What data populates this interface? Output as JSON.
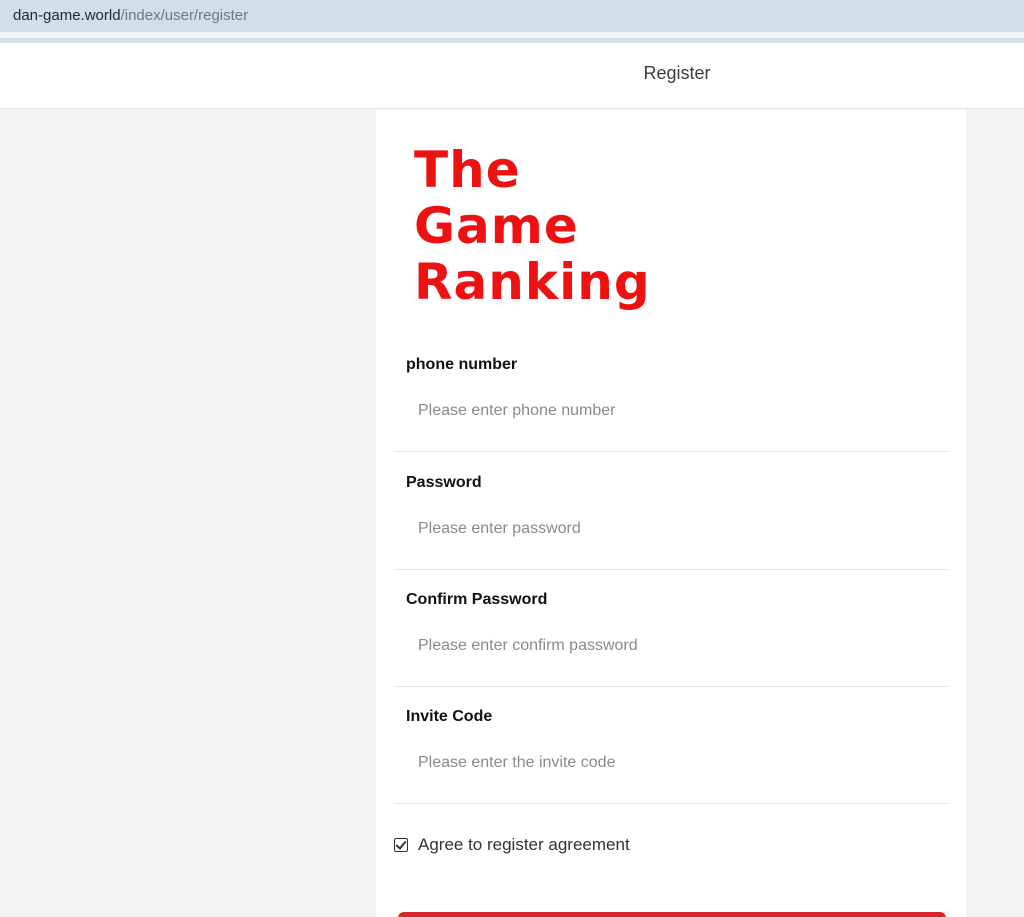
{
  "browser": {
    "url_host": "dan-game.world",
    "url_path": "/index/user/register"
  },
  "header": {
    "title": "Register"
  },
  "logo": {
    "lines": [
      "The",
      "Game",
      "Ranking"
    ],
    "color": "#ee1111"
  },
  "form": {
    "fields": [
      {
        "label": "phone number",
        "placeholder": "Please enter phone number",
        "value": ""
      },
      {
        "label": "Password",
        "placeholder": "Please enter password",
        "value": ""
      },
      {
        "label": "Confirm Password",
        "placeholder": "Please enter confirm password",
        "value": ""
      },
      {
        "label": "Invite Code",
        "placeholder": "Please enter the invite code",
        "value": ""
      }
    ],
    "agree_label": "Agree to register agreement",
    "agree_checked": true
  },
  "colors": {
    "accent": "#d8262e",
    "background": "#f2f4f3"
  }
}
